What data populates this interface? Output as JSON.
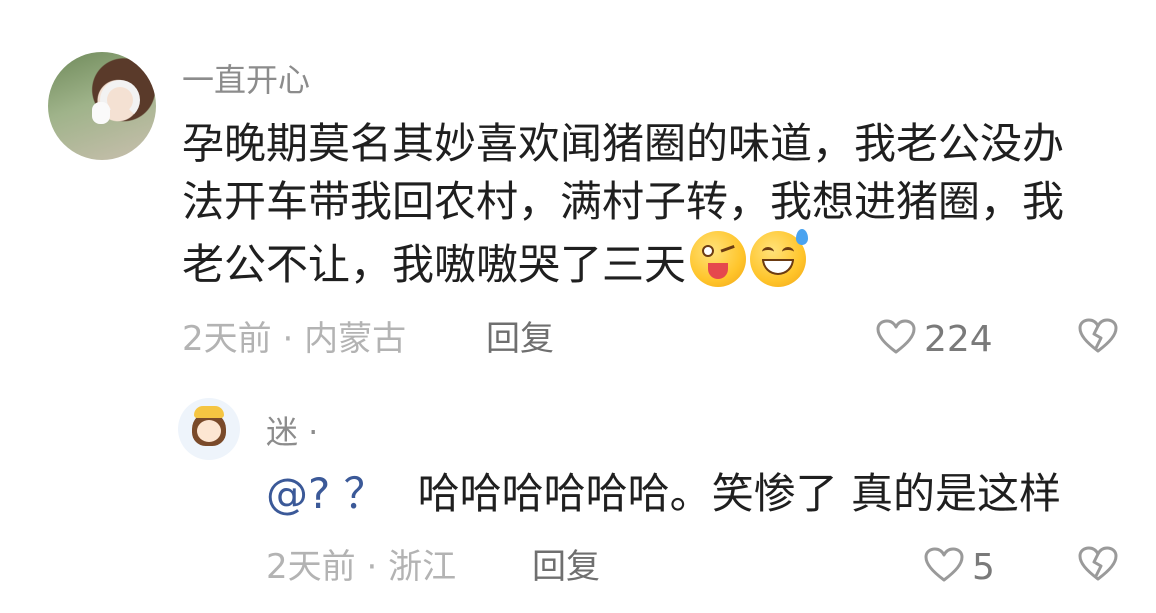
{
  "comment": {
    "username": "一直开心",
    "text": "孕晚期莫名其妙喜欢闻猪圈的味道，我老公没办法开车带我回农村，满村子转，我想进猪圈，我老公不让，我嗷嗷哭了三天",
    "emojis": [
      "winking-tongue-emoji",
      "grinning-sweat-emoji"
    ],
    "time": "2天前",
    "separator": " · ",
    "location": "内蒙古",
    "reply_label": "回复",
    "like_count": "224"
  },
  "reply": {
    "username": "迷 ·",
    "mention": "@? ？",
    "text": "哈哈哈哈哈哈。笑惨了 真的是这样",
    "time": "2天前",
    "separator": " · ",
    "location": "浙江",
    "reply_label": "回复",
    "like_count": "5"
  },
  "colors": {
    "muted": "#b3b3b3",
    "username": "#8c8c8c",
    "mention": "#3b5998",
    "text": "#1f1f1f"
  }
}
